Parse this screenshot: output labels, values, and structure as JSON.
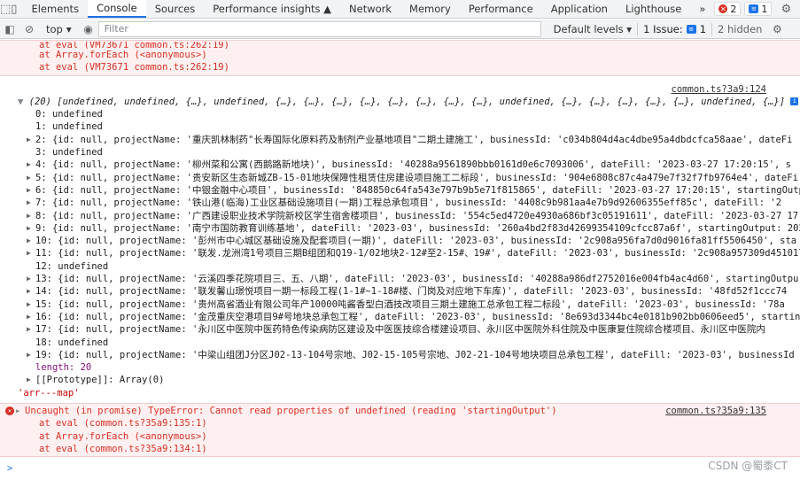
{
  "tabs": [
    "Elements",
    "Console",
    "Sources",
    "Performance insights ▲",
    "Network",
    "Memory",
    "Performance",
    "Application",
    "Lighthouse"
  ],
  "toolbar": {
    "more": "»",
    "errors_count": "2",
    "messages_count": "1"
  },
  "filter": {
    "context": "top",
    "placeholder": "Filter",
    "levels": "Default levels ▾",
    "issues_label": "1 Issue:",
    "issues_count": "1",
    "hidden": "2 hidden"
  },
  "top_error": {
    "lines": [
      "at eval (VM73671 common.ts:262:19)",
      "at Array.forEach (<anonymous>)",
      "at eval (VM73671 common.ts:262:19)"
    ]
  },
  "array_log": {
    "source": "common.ts?3a9:124",
    "header": "(20) [undefined, undefined, {…}, undefined, {…}, {…}, {…}, {…}, {…}, {…}, {…}, {…}, undefined, {…}, {…}, {…}, {…}, {…}, undefined, {…}]",
    "items": [
      "0: undefined",
      "1: undefined",
      "2: {id: null, projectName: '重庆凯林制药\"长寿国际化原料药及制剂产业基地项目\"二期土建施工', businessId: 'c034b804d4ac4dbe95a4dbdcfca58aae', dateFi",
      "3: undefined",
      "4: {id: null, projectName: '柳州菜和公寓(西鹅路新地块)', businessId: '40288a9561890bbb0161d0e6c7093006', dateFill: '2023-03-27 17:20:15', s",
      "5: {id: null, projectName: '贵安新区生态新城ZB-15-01地块保障性租赁住房建设项目施工二标段', businessId: '904e6808c87c4a479e7f32f7fb9764e4', dateFi",
      "6: {id: null, projectName: '中银金融中心项目', businessId: '848850c64fa543e797b9b5e71f815865', dateFill: '2023-03-27 17:20:15', startingOutpu",
      "7: {id: null, projectName: '铁山港(临海)工业区基础设施项目(一期)工程总承包项目', businessId: '4408c9b981aa4e7b9d92606355eff85c', dateFill: '2",
      "8: {id: null, projectName: '广西建设职业技术学院新校区学生宿舍楼项目', businessId: '554c5ed4720e4930a686bf3c05191611', dateFill: '2023-03-27 17",
      "9: {id: null, projectName: '南宁市国防教育训练基地', dateFill: '2023-03', businessId: '260a4bd2f83d42699354109cfcc87a6f', startingOutput: 2025",
      "10: {id: null, projectName: '彭州市中心城区基础设施及配套项目(一期)', dateFill: '2023-03', businessId: '2c908a956fa7d0d9016fa81ff5506450', sta",
      "11: {id: null, projectName: '联发.龙洲湾1号项目三期B组团和Q19-1/02地块2-12#至2-15#、19#', dateFill: '2023-03', businessId: '2c908a957309d451017",
      "12: undefined",
      "13: {id: null, projectName: '云溪四季花院项目三、五、八期', dateFill: '2023-03', businessId: '40288a986df2752016e004fb4ac4d60', startingOutpu",
      "14: {id: null, projectName: '联发馨山璟悦项目一期一标段工程(1-1#~1-18#楼、门岗及对应地下车库)', dateFill: '2023-03', businessId: '48fd52f1ccc74",
      "15: {id: null, projectName: '贵州高省酒业有限公司年产10000吨酱香型白酒技改项目三期土建施工总承包工程二标段', dateFill: '2023-03', businessId: '78a",
      "16: {id: null, projectName: '金茂重庆空港项目9#号地块总承包工程', dateFill: '2023-03', businessId: '8e693d3344bc4e0181b902bb0606eed5', starting",
      "17: {id: null, projectName: '永川区中医院中医药特色传染病防区建设及中医医技综合楼建设项目、永川区中医院外科住院及中医康复住院综合楼项目、永川区中医院内",
      "18: undefined",
      "19: {id: null, projectName: '中梁山组团J分区J02-13-104号宗地、J02-15-105号宗地、J02-21-104号地块项目总承包工程', dateFill: '2023-03', businessId",
      "length: 20",
      "[[Prototype]]: Array(0)"
    ]
  },
  "string_log": "'arr---map'",
  "error": {
    "message": "Uncaught (in promise) TypeError: Cannot read properties of undefined (reading 'startingOutput')",
    "source": "common.ts?35a9:135",
    "stack": [
      "at eval (common.ts?35a9:135:1)",
      "at Array.forEach (<anonymous>)",
      "at eval (common.ts?35a9:134:1)"
    ]
  },
  "prompt": ">",
  "watermark": "CSDN @蜀黍CT"
}
